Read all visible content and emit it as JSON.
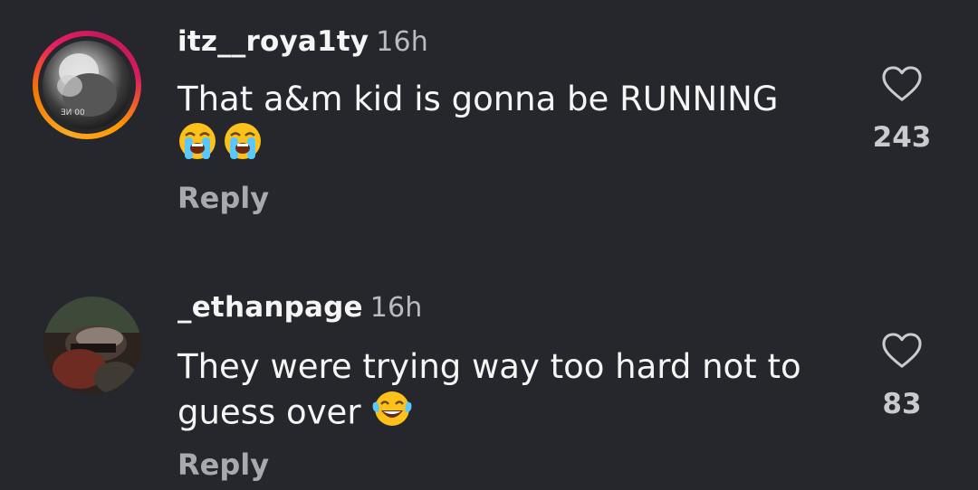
{
  "comments": [
    {
      "username": "itz__roya1ty",
      "time": "16h",
      "text": "That a&m kid is gonna be RUNNING",
      "emojis": [
        "loudly-crying-face",
        "loudly-crying-face"
      ],
      "reply_label": "Reply",
      "likes": "243",
      "has_story_ring": true
    },
    {
      "username": "_ethanpage",
      "time": "16h",
      "text": "They were trying way too hard not to guess over",
      "emojis": [
        "face-with-tears-of-joy"
      ],
      "reply_label": "Reply",
      "likes": "83",
      "has_story_ring": false
    }
  ],
  "colors": {
    "background": "#25272c",
    "text": "#f5f5f5",
    "muted": "#a7a9ae",
    "story_ring": [
      "#f9a825",
      "#e91e63"
    ]
  }
}
